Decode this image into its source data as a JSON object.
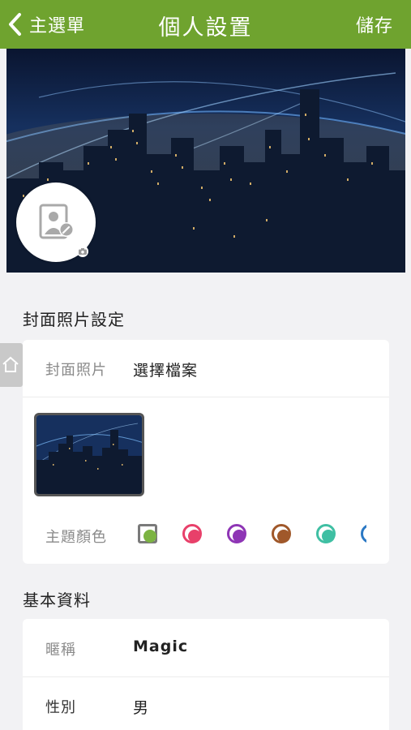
{
  "header": {
    "back_label": "主選單",
    "title": "個人設置",
    "save_label": "儲存"
  },
  "cover_section": {
    "title": "封面照片設定",
    "cover_photo_label": "封面照片",
    "choose_file_label": "選擇檔案",
    "theme_color_label": "主題顏色",
    "theme_colors": [
      "#7cb342",
      "#e8406a",
      "#8e35b5",
      "#a0582a",
      "#3fbfa3",
      "#2a78c4"
    ],
    "selected_color_index": 0
  },
  "basic_section": {
    "title": "基本資料",
    "nickname_label": "暱稱",
    "nickname_value": "Magic",
    "gender_label": "性別",
    "gender_value": "男"
  }
}
